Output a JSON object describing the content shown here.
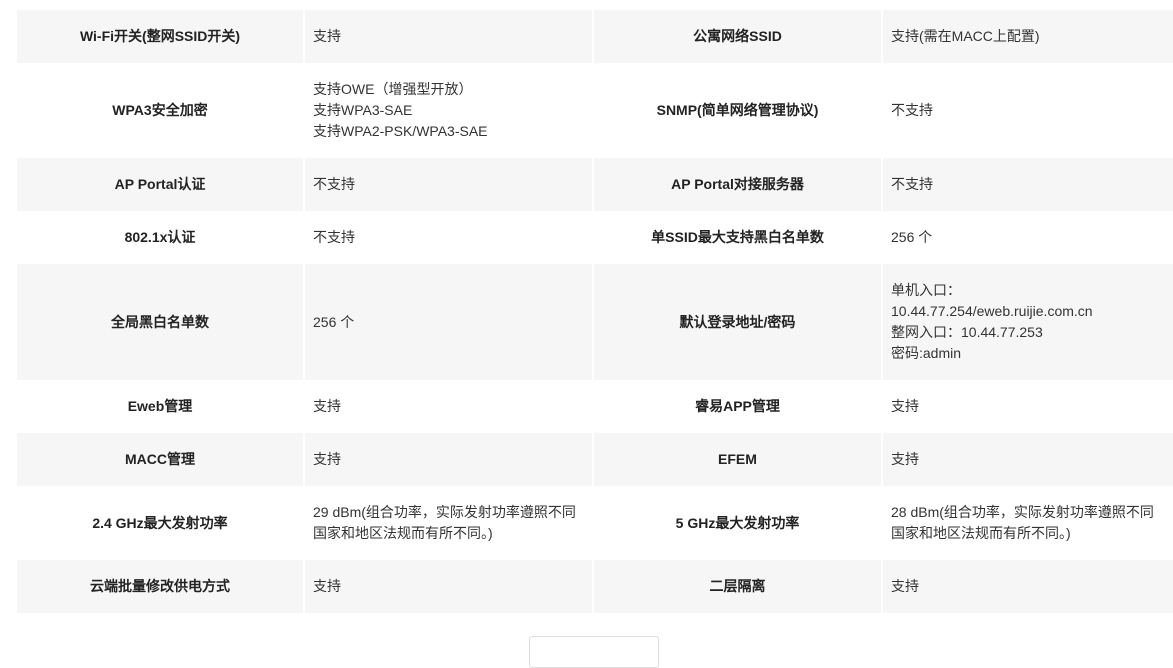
{
  "rows": [
    {
      "height": 53,
      "alt": true,
      "l1": "Wi-Fi开关(整网SSID开关)",
      "v1": [
        "支持"
      ],
      "l2": "公寓网络SSID",
      "v2": [
        "支持(需在MACC上配置)"
      ]
    },
    {
      "height": 95,
      "alt": false,
      "l1": "WPA3安全加密",
      "v1": [
        "支持OWE（增强型开放）",
        "支持WPA3-SAE",
        "支持WPA2-PSK/WPA3-SAE"
      ],
      "l2": "SNMP(简单网络管理协议)",
      "v2": [
        "不支持"
      ]
    },
    {
      "height": 53,
      "alt": true,
      "l1": "AP Portal认证",
      "v1": [
        "不支持"
      ],
      "l2": "AP Portal对接服务器",
      "v2": [
        "不支持"
      ]
    },
    {
      "height": 53,
      "alt": false,
      "l1": "802.1x认证",
      "v1": [
        "不支持"
      ],
      "l2": "单SSID最大支持黑白名单数",
      "v2": [
        "256 个"
      ]
    },
    {
      "height": 116,
      "alt": true,
      "l1": "全局黑白名单数",
      "v1": [
        "256 个"
      ],
      "l2": "默认登录地址/密码",
      "v2": [
        "单机入口：",
        "10.44.77.254/eweb.ruijie.com.cn",
        "整网入口：10.44.77.253",
        "密码:admin"
      ]
    },
    {
      "height": 53,
      "alt": false,
      "l1": "Eweb管理",
      "v1": [
        "支持"
      ],
      "l2": "睿易APP管理",
      "v2": [
        "支持"
      ]
    },
    {
      "height": 53,
      "alt": true,
      "l1": "MACC管理",
      "v1": [
        "支持"
      ],
      "l2": "EFEM",
      "v2": [
        "支持"
      ]
    },
    {
      "height": 74,
      "alt": false,
      "l1": "2.4 GHz最大发射功率",
      "v1": [
        "29 dBm(组合功率，实际发射功率遵照不同国家和地区法规而有所不同。)"
      ],
      "l2": "5 GHz最大发射功率",
      "v2": [
        "28 dBm(组合功率，实际发射功率遵照不同国家和地区法规而有所不同。)"
      ]
    },
    {
      "height": 53,
      "alt": true,
      "l1": "云端批量修改供电方式",
      "v1": [
        "支持"
      ],
      "l2": "二层隔离",
      "v2": [
        "支持"
      ]
    }
  ]
}
